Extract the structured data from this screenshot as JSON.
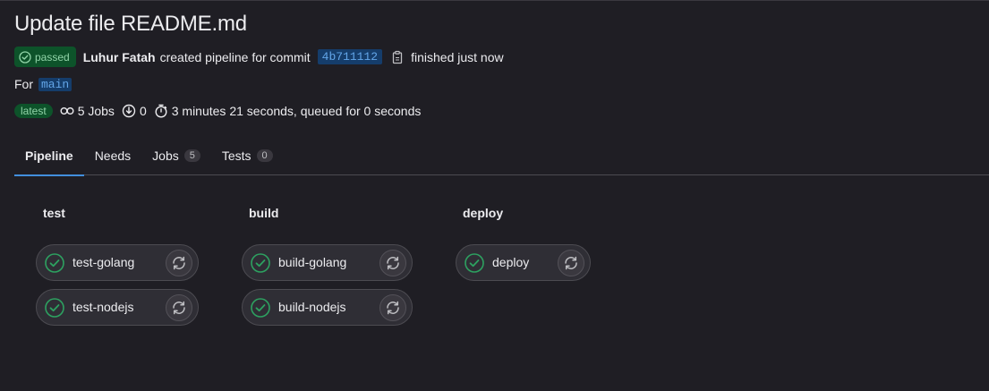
{
  "title": "Update file README.md",
  "header": {
    "status": "passed",
    "author": "Luhur Fatah",
    "action": "created pipeline for commit",
    "commit_sha": "4b711112",
    "finished": "finished just now",
    "for_label": "For",
    "branch": "main",
    "latest_label": "latest",
    "jobs": "5 Jobs",
    "warnings": "0",
    "duration": "3 minutes 21 seconds, queued for 0 seconds"
  },
  "tabs": [
    {
      "label": "Pipeline"
    },
    {
      "label": "Needs"
    },
    {
      "label": "Jobs",
      "count": "5"
    },
    {
      "label": "Tests",
      "count": "0"
    }
  ],
  "stages": [
    {
      "name": "test",
      "jobs": [
        "test-golang",
        "test-nodejs"
      ]
    },
    {
      "name": "build",
      "jobs": [
        "build-golang",
        "build-nodejs"
      ]
    },
    {
      "name": "deploy",
      "jobs": [
        "deploy"
      ]
    }
  ],
  "colors": {
    "success": "#2da160",
    "link": "#63a6e9",
    "active_tab": "#428fdc"
  },
  "icons": {
    "status": "status-success-icon",
    "copy": "copy-to-clipboard-icon",
    "jobs": "pipeline-icon",
    "warnings": "warning-icon",
    "duration": "timer-icon",
    "retry": "retry-icon"
  }
}
